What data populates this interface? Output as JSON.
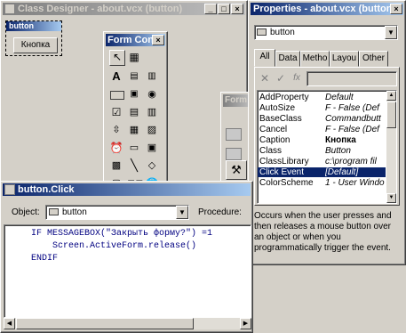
{
  "class_designer": {
    "title": "Class Designer - about.vcx (button)",
    "button_name": "button",
    "button_caption": "Кнопка"
  },
  "form_controls": {
    "title": "Form Cont"
  },
  "form_designer_partial": {
    "title": "Form"
  },
  "properties": {
    "title": "Properties - about.vcx (button)",
    "object_selector": "button",
    "tabs": [
      "All",
      "Data",
      "Metho",
      "Layou",
      "Other"
    ],
    "rows": [
      {
        "name": "AddProperty",
        "value": "Default"
      },
      {
        "name": "AutoSize",
        "value": "F - False (Def"
      },
      {
        "name": "BaseClass",
        "value": "Commandbutt"
      },
      {
        "name": "Cancel",
        "value": "F - False (Def"
      },
      {
        "name": "Caption",
        "value": "Кнопка"
      },
      {
        "name": "Class",
        "value": "Button"
      },
      {
        "name": "ClassLibrary",
        "value": "c:\\program fil"
      },
      {
        "name": "Click Event",
        "value": "[Default]"
      },
      {
        "name": "ColorScheme",
        "value": "1 - User Windo"
      }
    ],
    "description": "Occurs when the user presses and then releases a mouse button over an object or when you programmatically trigger the event."
  },
  "code_window": {
    "title": "button.Click",
    "object_label": "Object:",
    "object_value": "button",
    "procedure_label": "Procedure:",
    "lines": [
      "IF MESSAGEBOX(\"Закрыть форму?\") =1",
      "  Screen.ActiveForm.release()",
      "ENDIF"
    ]
  }
}
